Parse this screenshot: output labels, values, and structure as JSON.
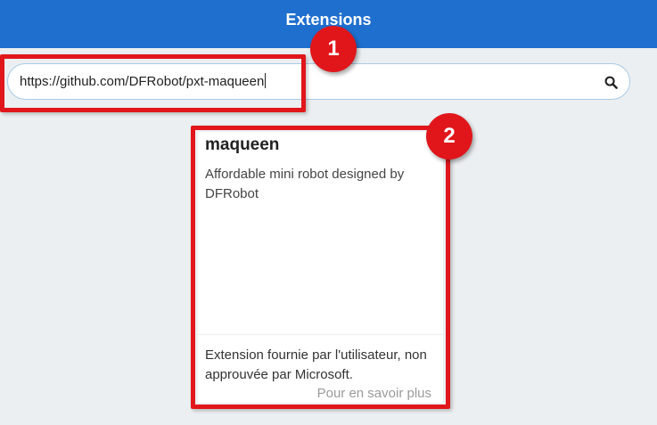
{
  "header": {
    "title": "Extensions"
  },
  "search": {
    "value": "https://github.com/DFRobot/pxt-maqueen"
  },
  "steps": [
    "1",
    "2"
  ],
  "card": {
    "title": "maqueen",
    "description": "Affordable mini robot designed by DFRobot",
    "note": "Extension fournie par l'utilisateur, non approuvée par Microsoft.",
    "learn_more": "Pour en savoir plus"
  },
  "colors": {
    "header": "#1f6fce",
    "highlight": "#e0161b",
    "background": "#eceff1"
  },
  "icons": {
    "search": "search-icon"
  }
}
